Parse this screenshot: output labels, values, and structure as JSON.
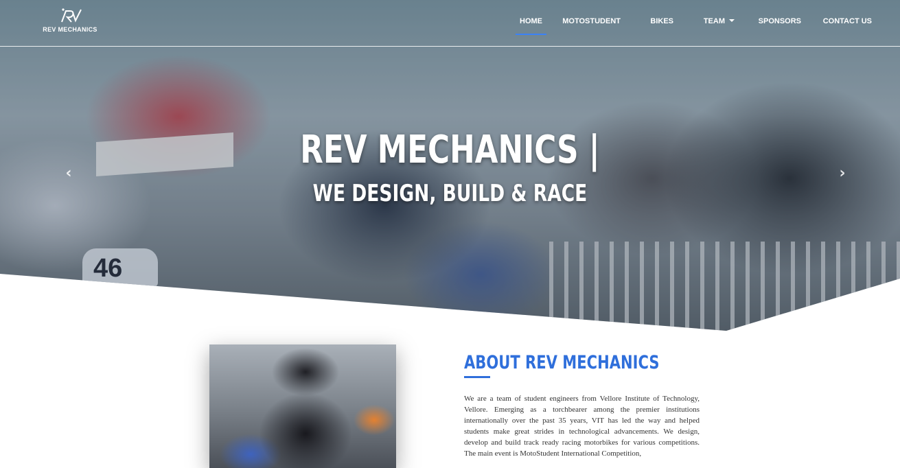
{
  "brand": {
    "name": "REV MECHANICS",
    "icon": "rv-logo-icon"
  },
  "nav": {
    "items": [
      {
        "label": "HOME",
        "active": true
      },
      {
        "label": "MOTOSTUDENT",
        "active": false
      },
      {
        "label": "BIKES",
        "active": false
      },
      {
        "label": "TEAM",
        "active": false,
        "dropdown": true
      },
      {
        "label": "SPONSORS",
        "active": false
      },
      {
        "label": "CONTACT US",
        "active": false
      }
    ],
    "active_color": "#3b82f6"
  },
  "hero": {
    "title": "REV MECHANICS |",
    "subtitle": "WE DESIGN, BUILD & RACE",
    "prev_icon": "chevron-left-icon",
    "next_icon": "chevron-right-icon",
    "plate_number": "46"
  },
  "about": {
    "heading": "ABOUT REV MECHANICS",
    "accent_color": "#2f6fdb",
    "body": "We are a team of student engineers from Vellore Institute of Technology, Vellore. Emerging as a torchbearer among the premier institutions internationally over the past 35 years, VIT has led the way and helped students make great strides in technological advancements. We design, develop and build track ready racing motorbikes for various competitions. The main event is MotoStudent International Competition,"
  }
}
